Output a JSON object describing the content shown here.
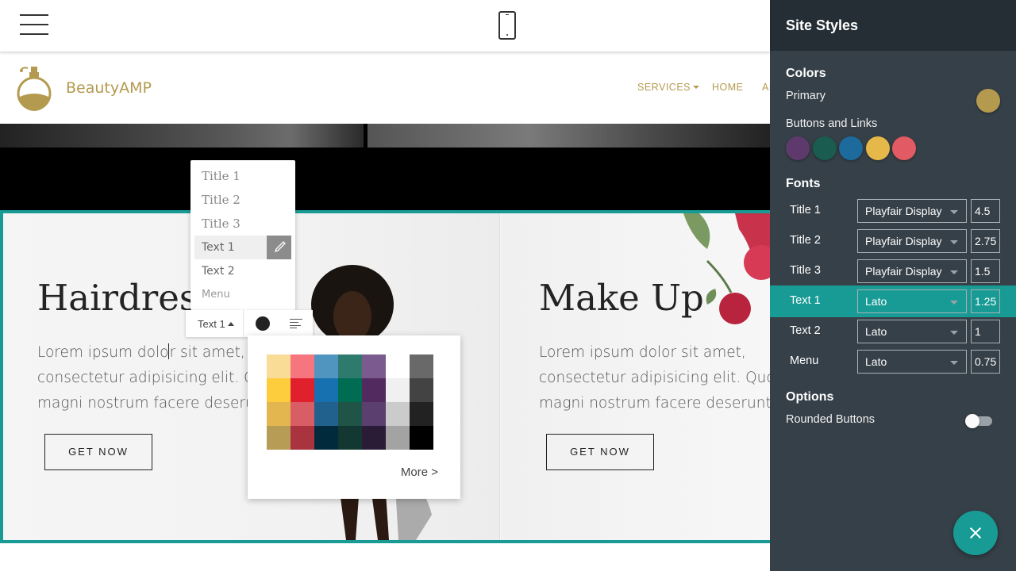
{
  "topbar": {
    "menu_icon": "hamburger-icon",
    "device_icon": "mobile-phone-icon"
  },
  "site": {
    "brand": "BeautyAMP",
    "logo_icon": "perfume-bottle-icon",
    "brand_color": "#b49a4e",
    "nav": [
      {
        "label": "SERVICES",
        "has_caret": true
      },
      {
        "label": "HOME"
      },
      {
        "label": "AB"
      }
    ]
  },
  "cards": [
    {
      "title": "Hairdress",
      "text_lines": [
        "Lorem ipsum dolor sit amet,",
        "consectetur adipisicing elit. Q",
        "magni nostrum facere deserun"
      ],
      "button": "GET NOW"
    },
    {
      "title": "Make Up",
      "text_lines": [
        "Lorem ipsum dolor sit amet,",
        "consectetur adipisicing elit. Quos",
        "magni nostrum facere deserunt."
      ],
      "button": "GET NOW"
    }
  ],
  "style_menu": {
    "items": [
      "Title 1",
      "Title 2",
      "Title 3",
      "Text 1",
      "Text 2",
      "Menu"
    ],
    "selected": "Text 1",
    "edit_icon": "brush-icon"
  },
  "text_toolbar": {
    "style_label": "Text 1",
    "color": "#222222",
    "align_icon": "align-left-icon"
  },
  "color_picker": {
    "columns": [
      [
        "#f9dc96",
        "#fecd3d",
        "#e3b650",
        "#b79c55"
      ],
      [
        "#f6757e",
        "#e0202d",
        "#d95d65",
        "#a9333e"
      ],
      [
        "#4f95bf",
        "#1771b0",
        "#20618d",
        "#012a3d"
      ],
      [
        "#2e7a6c",
        "#006d53",
        "#1f5447",
        "#133832"
      ],
      [
        "#7b5b8f",
        "#532a5f",
        "#5a3f6f",
        "#2a1c36"
      ],
      [
        "#ffffff",
        "#f0f0f0",
        "#cbcbcb",
        "#a3a3a3"
      ],
      [
        "#696969",
        "#434343",
        "#222222",
        "#000000"
      ]
    ],
    "more_label": "More >"
  },
  "panel": {
    "title": "Site Styles",
    "colors_heading": "Colors",
    "primary_label": "Primary",
    "primary_color": "#b49a4e",
    "buttons_label": "Buttons and Links",
    "button_colors": [
      "#5d3a6b",
      "#1a5c4f",
      "#1d6a9c",
      "#e6b84a",
      "#e25a63"
    ],
    "fonts_heading": "Fonts",
    "fonts": [
      {
        "label": "Title 1",
        "font": "Playfair Display",
        "size": "4.5"
      },
      {
        "label": "Title 2",
        "font": "Playfair Display",
        "size": "2.75"
      },
      {
        "label": "Title 3",
        "font": "Playfair Display",
        "size": "1.5"
      },
      {
        "label": "Text 1",
        "font": "Lato",
        "size": "1.25",
        "active": true
      },
      {
        "label": "Text 2",
        "font": "Lato",
        "size": "1"
      },
      {
        "label": "Menu",
        "font": "Lato",
        "size": "0.75"
      }
    ],
    "options_heading": "Options",
    "rounded_label": "Rounded Buttons",
    "rounded_on": false,
    "close_icon": "close-icon"
  }
}
